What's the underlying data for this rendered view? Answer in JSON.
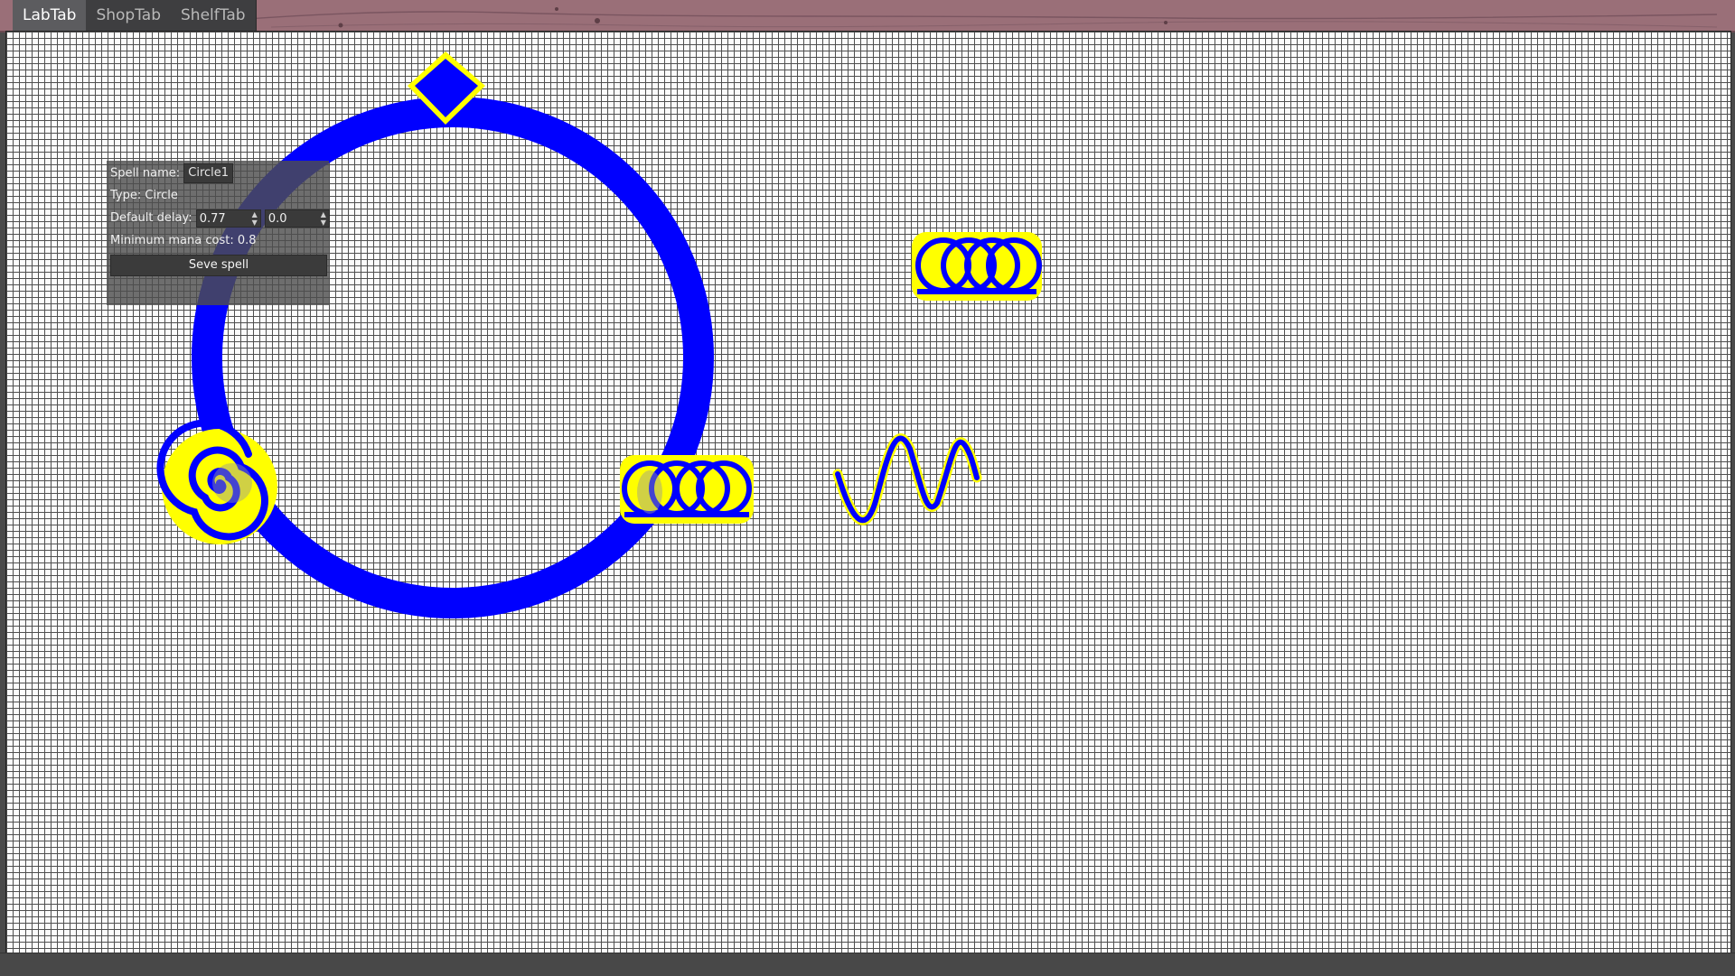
{
  "tabs": [
    {
      "label": "LabTab",
      "active": true
    },
    {
      "label": "ShopTab",
      "active": false
    },
    {
      "label": "ShelfTab",
      "active": false
    }
  ],
  "spell_panel": {
    "name_label": "Spell name:",
    "name_value": "Circle1",
    "type_label": "Type:",
    "type_value": "Circle",
    "delay_label": "Default delay:",
    "delay_value_1": "0.77",
    "delay_value_2": "0.0",
    "mana_label": "Minimum mana cost:",
    "mana_value": "0.8",
    "save_label": "Seve spell"
  },
  "colors": {
    "rune_stroke": "#0000ff",
    "rune_highlight": "#ffff00",
    "grid_line": "#4f4f4f",
    "canvas_bg": "#fbfbfb",
    "topbar": "#9a6f78"
  },
  "spell_components": [
    {
      "name": "circle-rune"
    },
    {
      "name": "diamond-node"
    },
    {
      "name": "spiral-rune"
    },
    {
      "name": "coil-rune-attached"
    },
    {
      "name": "coil-rune-free"
    },
    {
      "name": "wave-rune-free"
    }
  ]
}
